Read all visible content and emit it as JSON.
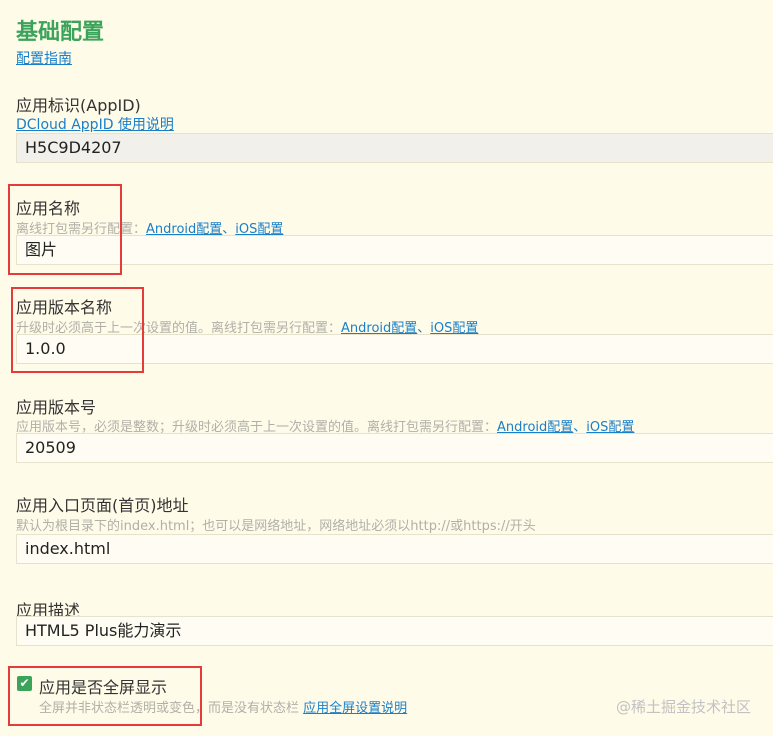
{
  "section": {
    "title": "基础配置",
    "guide_link": "配置指南"
  },
  "appid": {
    "label": "应用标识(AppID)",
    "help_link": "DCloud AppID 使用说明",
    "value": "H5C9D4207"
  },
  "app_name": {
    "label": "应用名称",
    "hint": "离线打包需另行配置：",
    "link_android": "Android配置",
    "separator": "、",
    "link_ios": "iOS配置",
    "value": "图片"
  },
  "version_name": {
    "label": "应用版本名称",
    "hint": "升级时必须高于上一次设置的值。离线打包需另行配置：",
    "link_android": "Android配置",
    "separator": "、",
    "link_ios": "iOS配置",
    "value": "1.0.0"
  },
  "version_code": {
    "label": "应用版本号",
    "hint": "应用版本号，必须是整数；升级时必须高于上一次设置的值。离线打包需另行配置：",
    "link_android": "Android配置",
    "separator": "、",
    "link_ios": "iOS配置",
    "value": "20509"
  },
  "entry_page": {
    "label": "应用入口页面(首页)地址",
    "hint": "默认为根目录下的index.html；也可以是网络地址，网络地址必须以http://或https://开头",
    "value": "index.html"
  },
  "description": {
    "label": "应用描述",
    "value": "HTML5 Plus能力演示"
  },
  "fullscreen": {
    "label": "应用是否全屏显示",
    "checked": true,
    "checkmark": "✔",
    "hint": "全屏并非状态栏透明或变色，而是没有状态栏",
    "link": "应用全屏设置说明"
  },
  "watermark": "@稀土掘金技术社区",
  "colors": {
    "title_green": "#3ba35a",
    "link_blue": "#1a7fc9",
    "highlight_red": "#e53b3b",
    "background": "#fffbe9"
  }
}
